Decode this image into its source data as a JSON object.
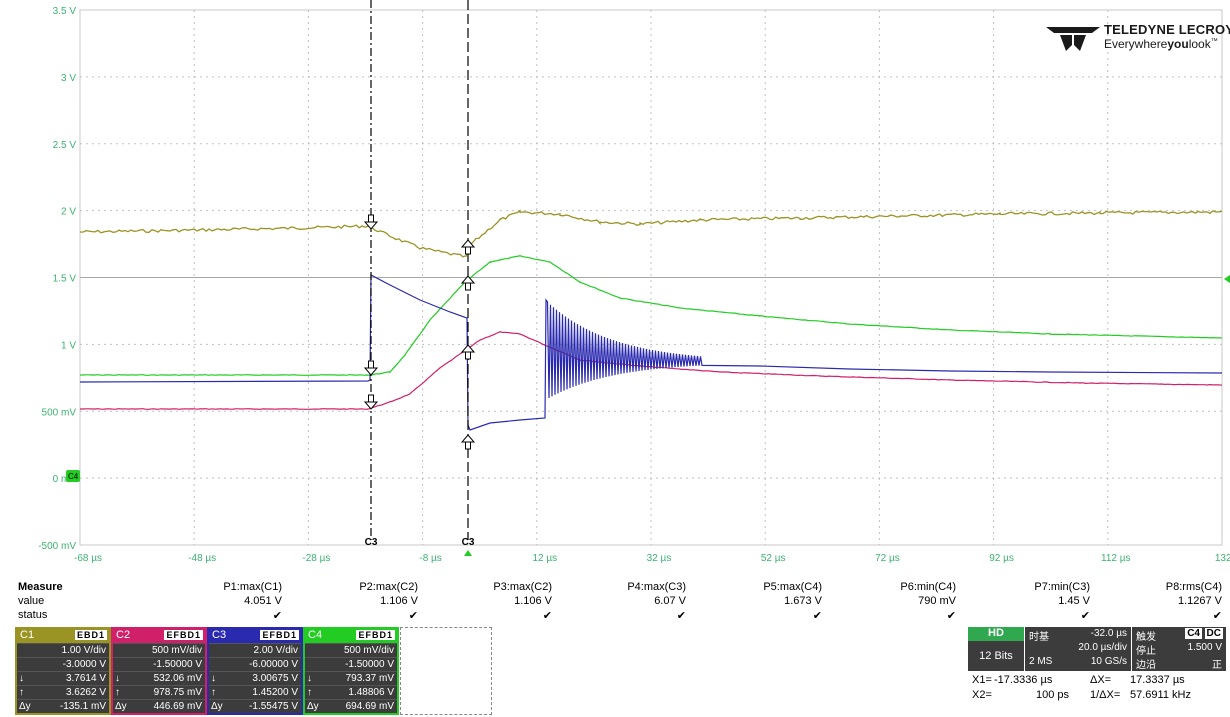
{
  "screen": {
    "y_axis_labels": [
      "3.5 V",
      "3 V",
      "2.5 V",
      "2 V",
      "1.5 V",
      "1 V",
      "500 mV",
      "0 mV",
      "-500 mV"
    ],
    "x_axis_labels": [
      "-68 µs",
      "-48 µs",
      "-28 µs",
      "-8 µs",
      "12 µs",
      "32 µs",
      "52 µs",
      "72 µs",
      "92 µs",
      "112 µs",
      "132 µs"
    ],
    "cursor_labels": [
      "C3",
      "C3"
    ],
    "ground_marker": "C4",
    "colors": {
      "c1": "#9a9424",
      "c2": "#d0206a",
      "c3": "#2a2ab0",
      "c4": "#22cc22",
      "grid": "#b8b8b8",
      "axis_text": "#3cb371"
    }
  },
  "logo": {
    "brand": "TELEDYNE LECROY",
    "tag_pre": "Everywhere",
    "tag_bold": "you",
    "tag_post": "look",
    "trademark": "™"
  },
  "measure": {
    "title": "Measure",
    "row_value_label": "value",
    "row_status_label": "status",
    "params": [
      {
        "name": "P1:max(C1)",
        "value": "4.051 V"
      },
      {
        "name": "P2:max(C2)",
        "value": "1.106 V"
      },
      {
        "name": "P3:max(C2)",
        "value": "1.106 V"
      },
      {
        "name": "P4:max(C3)",
        "value": "6.07 V"
      },
      {
        "name": "P5:max(C4)",
        "value": "1.673 V"
      },
      {
        "name": "P6:min(C4)",
        "value": "790 mV"
      },
      {
        "name": "P7:min(C3)",
        "value": "1.45 V"
      },
      {
        "name": "P8:rms(C4)",
        "value": "1.1267 V"
      }
    ],
    "status_mark": "✔"
  },
  "channels": [
    {
      "name": "C1",
      "flags": "EBD1",
      "color": "#9a9424",
      "vdiv": "1.00 V/div",
      "offset": "-3.0000 V",
      "s1": "↓",
      "c1": "3.7614 V",
      "s2": "↑",
      "c2": "3.6262 V",
      "s3": "Δy",
      "dy": "-135.1 mV"
    },
    {
      "name": "C2",
      "flags": "EFBD1",
      "color": "#d0206a",
      "vdiv": "500 mV/div",
      "offset": "-1.50000 V",
      "s1": "↓",
      "c1": "532.06 mV",
      "s2": "↑",
      "c2": "978.75 mV",
      "s3": "Δy",
      "dy": "446.69 mV"
    },
    {
      "name": "C3",
      "flags": "EFBD1",
      "color": "#2a2ab0",
      "vdiv": "2.00 V/div",
      "offset": "-6.00000 V",
      "s1": "↓",
      "c1": "3.00675 V",
      "s2": "↑",
      "c2": "1.45200 V",
      "s3": "Δy",
      "dy": "-1.55475 V"
    },
    {
      "name": "C4",
      "flags": "EFBD1",
      "color": "#22cc22",
      "vdiv": "500 mV/div",
      "offset": "-1.50000 V",
      "s1": "↓",
      "c1": "793.37 mV",
      "s2": "↑",
      "c2": "1.48806 V",
      "s3": "Δy",
      "dy": "694.69 mV"
    }
  ],
  "timebase": {
    "mode": "HD",
    "bits": "12 Bits",
    "tb_label": "时基",
    "delay": "-32.0 µs",
    "tdiv": "20.0 µs/div",
    "points": "2 MS",
    "rate": "10 GS/s",
    "trig_label": "触发",
    "trig_src": "C4",
    "trig_cpl": "DC",
    "trig_mode": "停止",
    "trig_level": "1.500 V",
    "trig_edge": "边沿",
    "trig_slope": "正"
  },
  "cursors": {
    "x1_label": "X1=",
    "x1": "-17.3336 µs",
    "dx_label": "ΔX=",
    "dx": "17.3337 µs",
    "x2_label": "X2=",
    "x2": "100 ps",
    "inv_label": "1/ΔX=",
    "inv": "57.6911 kHz"
  }
}
